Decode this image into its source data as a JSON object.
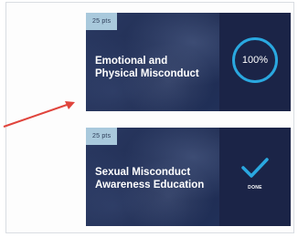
{
  "courses": [
    {
      "points": "25 pts",
      "title_line1": "Emotional and",
      "title_line2": "Physical Misconduct",
      "progress_label": "100%",
      "progress": 1.0
    },
    {
      "points": "25 pts",
      "title_line1": "Sexual Misconduct",
      "title_line2": "Awareness Education",
      "status_label": "DONE"
    }
  ],
  "colors": {
    "card_bg": "#1d2a4f",
    "panel_bg": "#1b2447",
    "points_badge": "#a9c9dc",
    "accent": "#2aa8e0",
    "annotation_arrow": "#e0443c"
  },
  "icons": {
    "arrow": "annotation-arrow-icon",
    "check": "checkmark-icon"
  }
}
